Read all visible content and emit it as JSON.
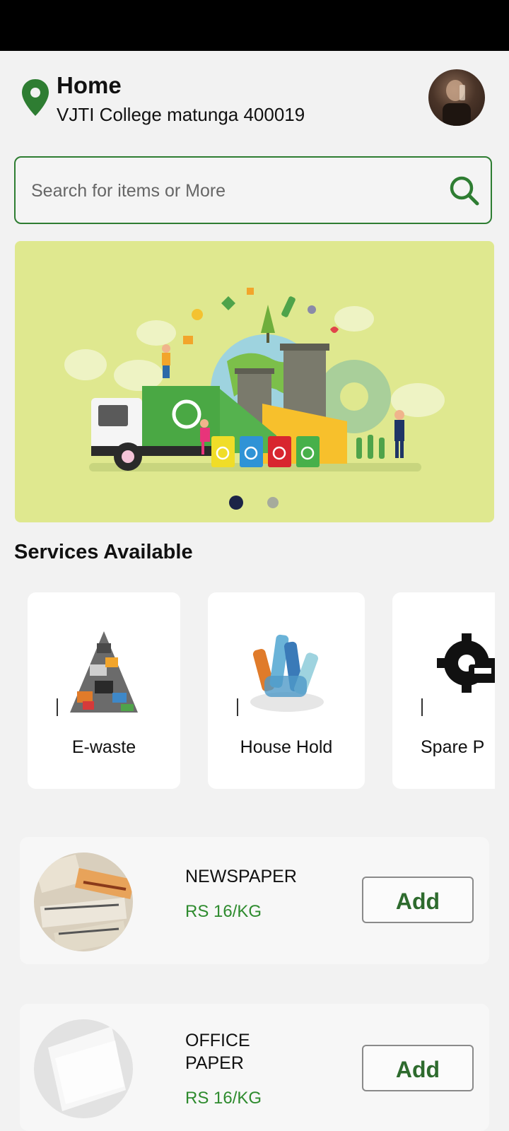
{
  "location": {
    "title": "Home",
    "address": "VJTI College matunga 400019"
  },
  "search": {
    "placeholder": "Search for items or More"
  },
  "banner": {
    "slide_count": 2,
    "active_slide": 1
  },
  "services": {
    "title": "Services Available",
    "items": [
      {
        "label": "E-waste",
        "icon": "e-waste-pile-image"
      },
      {
        "label": "House Hold",
        "icon": "plastic-bottles-image"
      },
      {
        "label": "Spare P",
        "icon": "gear-car-icon"
      }
    ]
  },
  "products": [
    {
      "name": "NEWSPAPER",
      "price": "RS 16/KG",
      "button": "Add",
      "image": "newspaper-image"
    },
    {
      "name": "OFFICE\nPAPER",
      "name_line1": "OFFICE",
      "name_line2": "PAPER",
      "price": "RS 16/KG",
      "button": "Add",
      "image": "office-paper-image"
    }
  ],
  "colors": {
    "accent": "#2e7d32",
    "price": "#2e8b2e",
    "banner_bg": "#dfe88f",
    "page_bg": "#f2f2f2"
  }
}
